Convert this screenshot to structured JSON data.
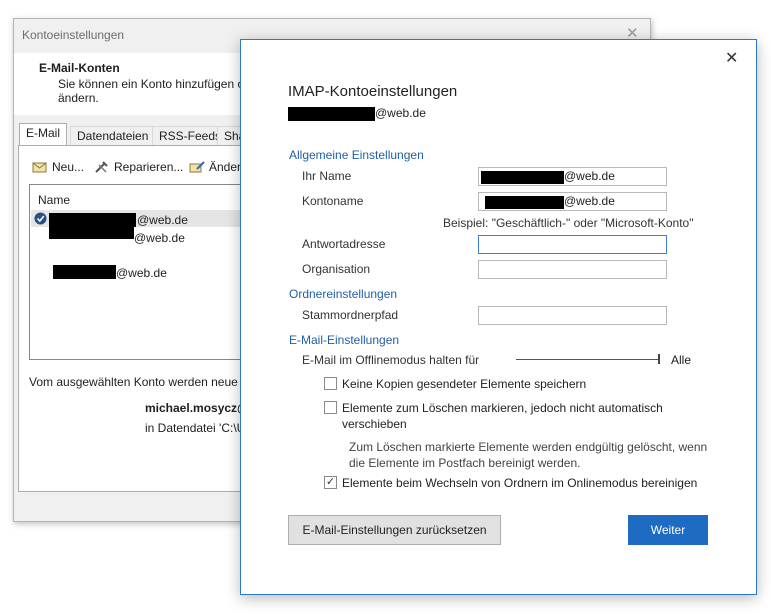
{
  "back_window": {
    "title": "Kontoeinstellungen",
    "close_glyph": "✕",
    "header_title": "E-Mail-Konten",
    "header_desc": "Sie können ein Konto hinzufügen o ändern.",
    "tabs": [
      {
        "label": "E-Mail",
        "active": true
      },
      {
        "label": "Datendateien"
      },
      {
        "label": "RSS-Feeds"
      },
      {
        "label": "Sha"
      }
    ],
    "toolbar": {
      "new": "Neu...",
      "repair": "Reparieren...",
      "change": "Änder"
    },
    "list_header": "Name",
    "accounts": [
      "@web.de",
      "@web.de",
      "@web.de"
    ],
    "footer_text": "Vom ausgewählten Konto werden neue N",
    "footer_account": "michael.mosycz@w",
    "footer_datafile": "in Datendatei 'C:\\U"
  },
  "dialog": {
    "title": "IMAP-Kontoeinstellungen",
    "close_glyph": "✕",
    "email_suffix": "@web.de",
    "sections": {
      "general": "Allgemeine Einstellungen",
      "folder": "Ordnereinstellungen",
      "mail": "E-Mail-Einstellungen"
    },
    "fields": {
      "name_label": "Ihr Name",
      "name_value": "@web.de",
      "account_label": "Kontoname",
      "account_value": "@web.de",
      "example": "Beispiel: \"Geschäftlich-\" oder \"Microsoft-Konto\"",
      "reply_label": "Antwortadresse",
      "reply_value": "",
      "org_label": "Organisation",
      "org_value": "",
      "root_label": "Stammordnerpfad",
      "root_value": ""
    },
    "offline": {
      "label": "E-Mail im Offlinemodus halten für",
      "value": "Alle",
      "level": 1.0
    },
    "checkboxes": [
      {
        "label": "Keine Kopien gesendeter Elemente speichern",
        "checked": false
      },
      {
        "label": "Elemente zum Löschen markieren, jedoch nicht automatisch verschieben",
        "checked": false
      },
      {
        "label": "Elemente beim Wechseln von Ordnern im Onlinemodus bereinigen",
        "checked": true
      }
    ],
    "note": "Zum Löschen markierte Elemente werden endgültig gelöscht, wenn die Elemente im Postfach bereinigt werden.",
    "buttons": {
      "reset": "E-Mail-Einstellungen zurücksetzen",
      "next": "Weiter"
    },
    "colors": {
      "accent": "#1e6bc4",
      "section": "#1f5fa8"
    }
  }
}
